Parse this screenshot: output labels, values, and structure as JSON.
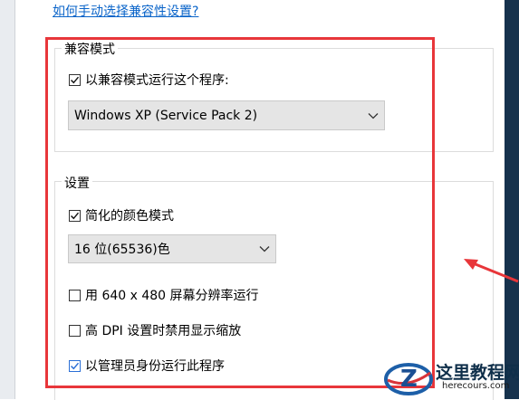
{
  "help_link": "如何手动选择兼容性设置?",
  "compat_group": {
    "title": "兼容模式",
    "checkbox_label": "以兼容模式运行这个程序:",
    "checked": true,
    "os_select": "Windows XP (Service Pack 2)",
    "os_select_icon": "chevron-down-icon"
  },
  "settings_group": {
    "title": "设置",
    "reduced_color": {
      "label": "简化的颜色模式",
      "checked": true
    },
    "color_select": "16 位(65536)色",
    "run_640": {
      "label": "用 640 x 480 屏幕分辨率运行",
      "checked": false
    },
    "dpi_disable": {
      "label": "高 DPI 设置时禁用显示缩放",
      "checked": false
    },
    "run_admin": {
      "label": "以管理员身份运行此程序",
      "checked": true
    }
  },
  "annotation": {
    "highlight_color": "#e8363a"
  },
  "watermark": {
    "title": "这里教程网",
    "url": "herecours.com",
    "logo_letter": "Z"
  }
}
